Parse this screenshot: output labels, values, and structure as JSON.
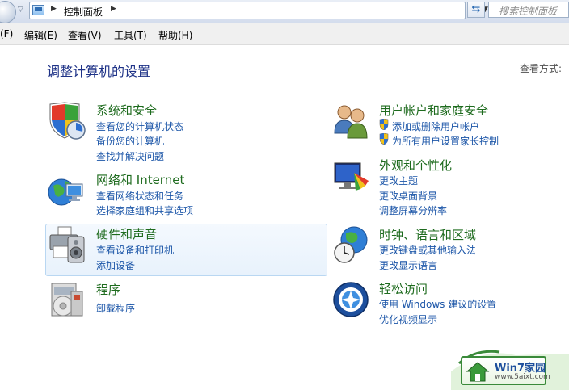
{
  "address_bar": {
    "path": "控制面板",
    "search_placeholder": "搜索控制面板"
  },
  "menu": [
    "(F)",
    "编辑(E)",
    "查看(V)",
    "工具(T)",
    "帮助(H)"
  ],
  "page": {
    "title": "调整计算机的设置",
    "view_by_label": "查看方式:"
  },
  "categories": {
    "system": {
      "title": "系统和安全",
      "links": [
        "查看您的计算机状态",
        "备份您的计算机",
        "查找并解决问题"
      ]
    },
    "network": {
      "title": "网络和 Internet",
      "links": [
        "查看网络状态和任务",
        "选择家庭组和共享选项"
      ]
    },
    "hardware": {
      "title": "硬件和声音",
      "links": [
        "查看设备和打印机",
        "添加设备"
      ]
    },
    "programs": {
      "title": "程序",
      "links": [
        "卸载程序"
      ]
    },
    "users": {
      "title": "用户帐户和家庭安全",
      "links": [
        "添加或删除用户帐户",
        "为所有用户设置家长控制"
      ]
    },
    "appearance": {
      "title": "外观和个性化",
      "links": [
        "更改主题",
        "更改桌面背景",
        "调整屏幕分辨率"
      ]
    },
    "clock": {
      "title": "时钟、语言和区域",
      "links": [
        "更改键盘或其他输入法",
        "更改显示语言"
      ]
    },
    "ease": {
      "title": "轻松访问",
      "links": [
        "使用 Windows 建议的设置",
        "优化视频显示"
      ]
    }
  },
  "watermark": {
    "title": "Win7家园",
    "url": "www.5aixt.com"
  },
  "colors": {
    "category_title": "#1e6b1e",
    "link": "#1c56a8",
    "page_title": "#1e3287"
  }
}
